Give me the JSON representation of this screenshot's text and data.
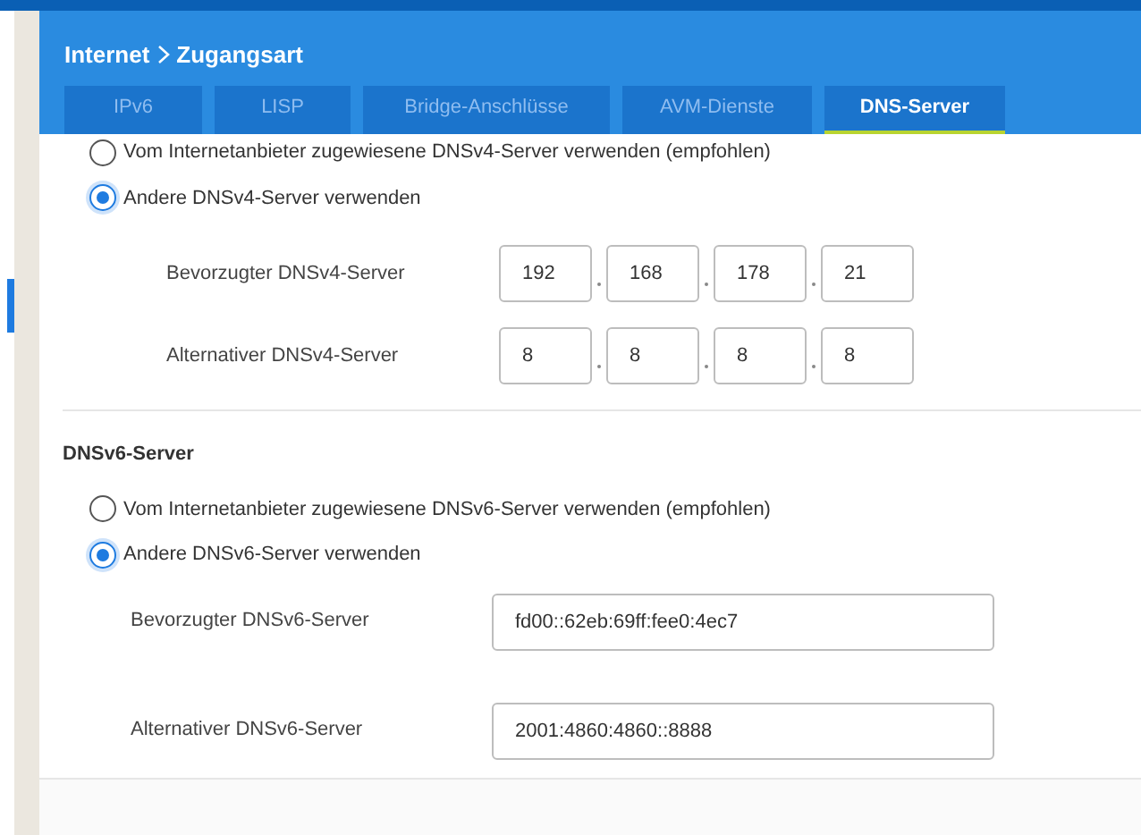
{
  "breadcrumb": {
    "parent": "Internet",
    "current": "Zugangsart"
  },
  "tabs": [
    {
      "label": "IPv6",
      "selected": false
    },
    {
      "label": "LISP",
      "selected": false
    },
    {
      "label": "Bridge-Anschlüsse",
      "selected": false
    },
    {
      "label": "AVM-Dienste",
      "selected": false
    },
    {
      "label": "DNS-Server",
      "selected": true
    }
  ],
  "dnsv4": {
    "options": [
      {
        "label": "Vom Internetanbieter zugewiesene DNSv4-Server verwenden (empfohlen)",
        "selected": false
      },
      {
        "label": "Andere DNSv4-Server verwenden",
        "selected": true
      }
    ],
    "fields": [
      {
        "label": "Bevorzugter DNSv4-Server",
        "octets": [
          "192",
          "168",
          "178",
          "21"
        ]
      },
      {
        "label": "Alternativer DNSv4-Server",
        "octets": [
          "8",
          "8",
          "8",
          "8"
        ]
      }
    ]
  },
  "dnsv6": {
    "title": "DNSv6-Server",
    "options": [
      {
        "label": "Vom Internetanbieter zugewiesene DNSv6-Server verwenden (empfohlen)",
        "selected": false
      },
      {
        "label": "Andere DNSv6-Server verwenden",
        "selected": true
      }
    ],
    "fields": [
      {
        "label": "Bevorzugter DNSv6-Server",
        "value": "fd00::62eb:69ff:fee0:4ec7"
      },
      {
        "label": "Alternativer DNSv6-Server",
        "value": "2001:4860:4860::8888"
      }
    ]
  }
}
